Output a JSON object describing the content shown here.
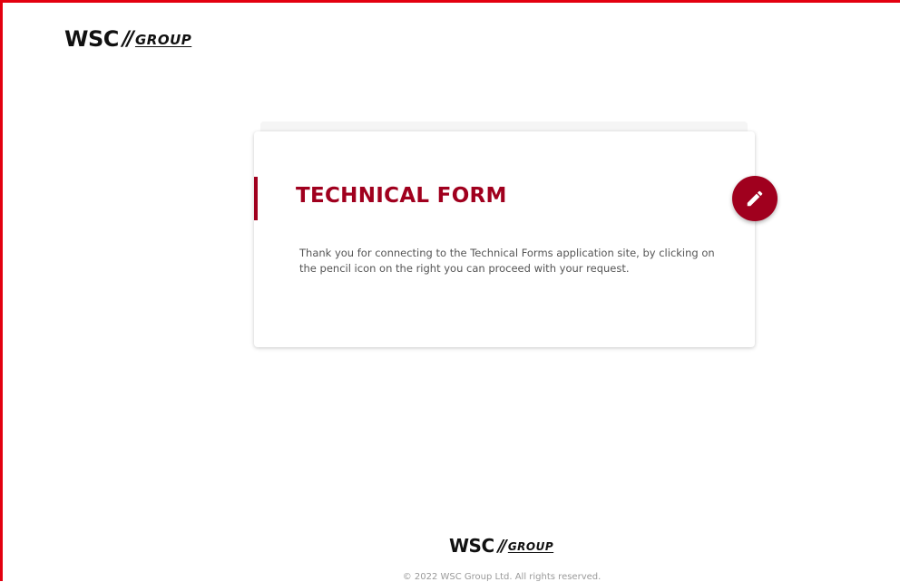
{
  "header": {
    "logo": {
      "wsc": "WSC",
      "slashes": "//",
      "group": "GROUP"
    }
  },
  "card": {
    "title": "TECHNICAL FORM",
    "text": "Thank you for connecting to the Technical Forms application site, by clicking on the pencil icon on the right you can proceed with your request.",
    "action_icon": "pencil-icon"
  },
  "footer": {
    "logo": {
      "wsc": "WSC",
      "slashes": "//",
      "group": "GROUP"
    },
    "copyright": "© 2022 WSC Group Ltd. All rights reserved."
  },
  "colors": {
    "accent": "#a0001e",
    "frame_border": "#e3000f"
  }
}
